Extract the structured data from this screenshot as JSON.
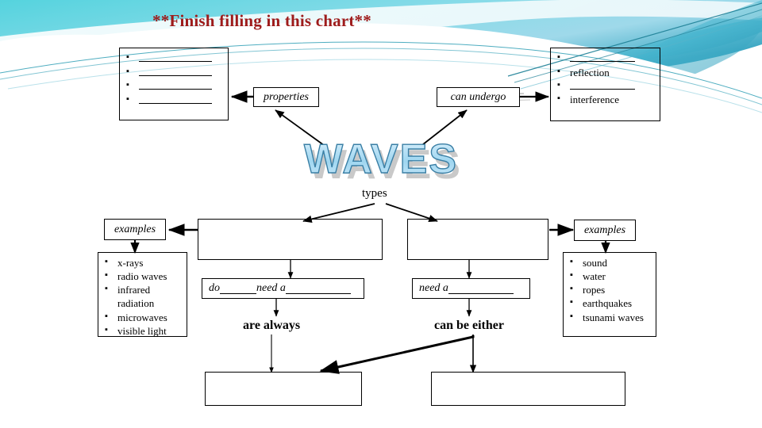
{
  "slide": {
    "title": "**Finish filling in this chart**",
    "title_color": "#9e1b1b",
    "background_theme_colors": [
      "#5fd0dd",
      "#2fa6bd",
      "#9fdce8",
      "#1d7f96",
      "#ffffff"
    ],
    "center_word": "WAVES",
    "center_word_fill": "#bfe4f5",
    "center_word_outline": "#3a7fa5",
    "center_word_shadow": "#c9c9c9"
  },
  "labels": {
    "properties": "properties",
    "can_undergo": "can undergo",
    "types": "types",
    "examples_left": "examples",
    "examples_right": "examples"
  },
  "properties_box": {
    "bullets": [
      "",
      "",
      "",
      ""
    ],
    "blanks": [
      true,
      true,
      true,
      true
    ]
  },
  "undergo_box": {
    "bullets": [
      "",
      "reflection",
      "",
      "interference"
    ],
    "blanks": [
      true,
      false,
      true,
      false
    ]
  },
  "left_branch": {
    "type_box_text": "",
    "condition_text": "do _____ need a ________",
    "condition_prefix": "do ",
    "condition_middle": "need a ",
    "always_text": "are always",
    "answer_box_text": "",
    "examples": [
      "x-rays",
      "radio waves",
      "infrared radiation",
      "microwaves",
      "visible light"
    ]
  },
  "right_branch": {
    "type_box_text": "",
    "condition_text": "need a ________",
    "condition_prefix": "need a ",
    "either_text": "can be either",
    "answer_box_text": "",
    "examples": [
      "sound",
      "water",
      "ropes",
      "earthquakes",
      "tsunami waves"
    ]
  }
}
